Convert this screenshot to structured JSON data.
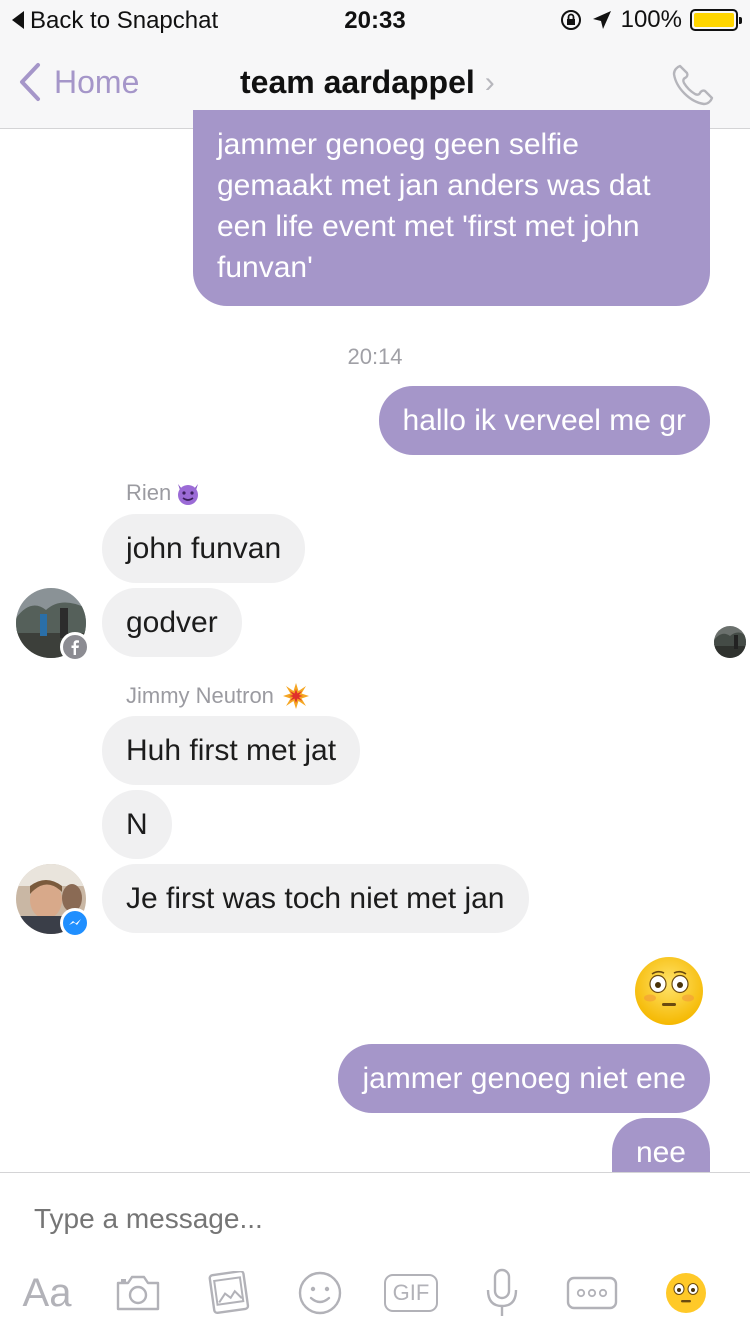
{
  "status_bar": {
    "back_label": "Back to Snapchat",
    "time": "20:33",
    "battery": "100%",
    "battery_level": 1.0,
    "battery_color": "#ffd500"
  },
  "nav": {
    "back_label": "Home",
    "title": "team aardappel",
    "title_chevron": "›",
    "accent_color": "#a596c9"
  },
  "messages": {
    "m1_lines": [
      "jammer genoeg geen selfie",
      "gemaakt met jan anders was dat",
      "een life event met 'first met john",
      "funvan'"
    ],
    "time_divider": "20:14",
    "m2": "hallo ik verveel me gr",
    "sender_rien": "Rien",
    "m3": "john funvan",
    "m4": "godver",
    "sender_jimmy": "Jimmy Neutron",
    "m5": "Huh first met jat",
    "m6": "N",
    "m7": "Je first was toch niet met jan",
    "m8": "jammer genoeg niet ene",
    "m9": "nee"
  },
  "composer": {
    "placeholder": "Type a message...",
    "aa_label": "Aa",
    "gif_label": "GIF",
    "icons": [
      "camera-icon",
      "gallery-icon",
      "sticker-icon",
      "gif-icon",
      "microphone-icon",
      "more-icon",
      "emoji-icon"
    ]
  }
}
